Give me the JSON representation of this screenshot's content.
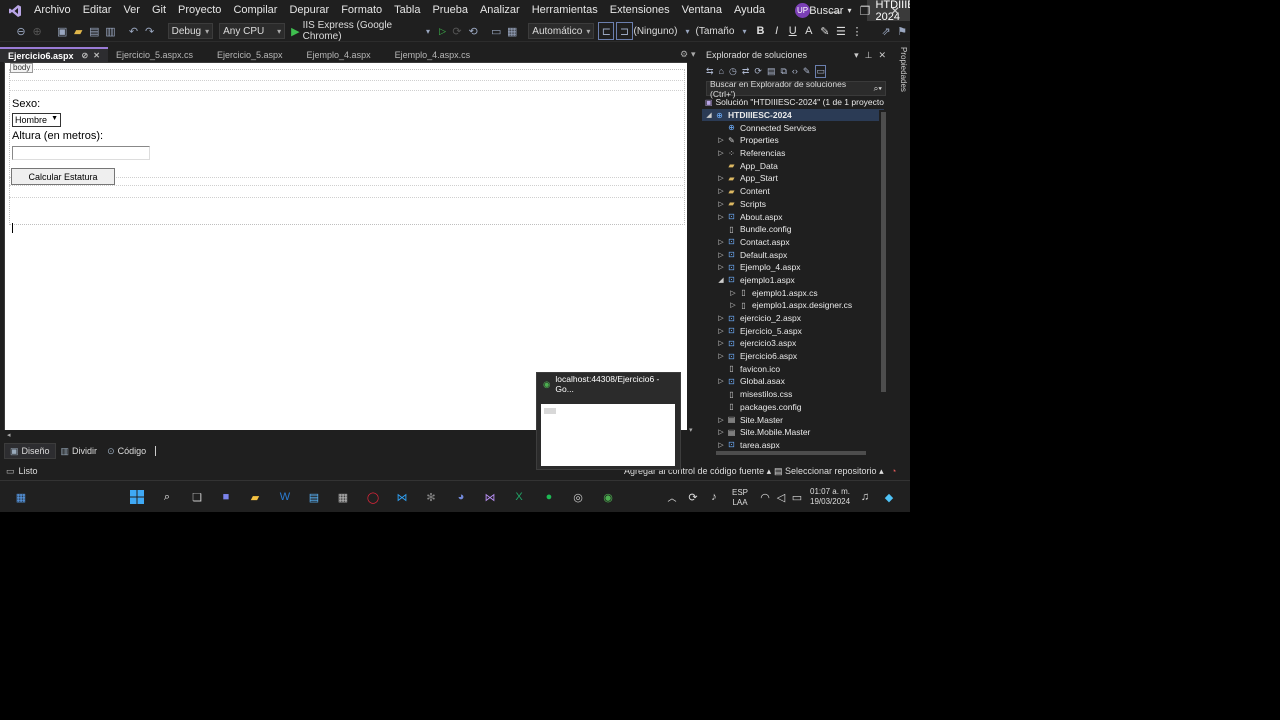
{
  "menu": {
    "items": [
      "Archivo",
      "Editar",
      "Ver",
      "Git",
      "Proyecto",
      "Compilar",
      "Depurar",
      "Formato",
      "Tabla",
      "Prueba",
      "Analizar",
      "Herramientas",
      "Extensiones",
      "Ventana",
      "Ayuda"
    ],
    "search_label": "Buscar",
    "solution_badge": "HTDIIIESC-2024",
    "avatar_initials": "UP"
  },
  "toolbar": {
    "config": "Debug",
    "platform": "Any CPU",
    "run_label": "IIS Express (Google Chrome)",
    "mode": "Automático",
    "style": "(Ninguno)",
    "size": "(Tamaño"
  },
  "doc_tabs": [
    {
      "label": "Ejercicio6.aspx",
      "active": true
    },
    {
      "label": "Ejercicio_5.aspx.cs"
    },
    {
      "label": "Ejercicio_5.aspx"
    },
    {
      "label": "Ejemplo_4.aspx"
    },
    {
      "label": "Ejemplo_4.aspx.cs"
    }
  ],
  "design": {
    "body_tag": "body",
    "sexo_label": "Sexo:",
    "select_value": "Hombre",
    "altura_label": "Altura (en metros):",
    "button_label": "Calcular Estatura"
  },
  "view_tabs": [
    "Diseño",
    "Dividir",
    "Código"
  ],
  "solution_explorer": {
    "title": "Explorador de soluciones",
    "search_placeholder": "Buscar en Explorador de soluciones (Ctrl+')",
    "solution_label": "Solución \"HTDIIIESC-2024\" (1 de 1 proyecto",
    "project": "HTDIIIESC-2024",
    "items": [
      {
        "label": "Connected Services",
        "indent": 2,
        "exp": "",
        "icon": "globe"
      },
      {
        "label": "Properties",
        "indent": 2,
        "exp": "▷",
        "icon": "wrench"
      },
      {
        "label": "Referencias",
        "indent": 2,
        "exp": "▷",
        "icon": "ref"
      },
      {
        "label": "App_Data",
        "indent": 2,
        "exp": "",
        "icon": "folder"
      },
      {
        "label": "App_Start",
        "indent": 2,
        "exp": "▷",
        "icon": "folder"
      },
      {
        "label": "Content",
        "indent": 2,
        "exp": "▷",
        "icon": "folder"
      },
      {
        "label": "Scripts",
        "indent": 2,
        "exp": "▷",
        "icon": "folder"
      },
      {
        "label": "About.aspx",
        "indent": 2,
        "exp": "▷",
        "icon": "page"
      },
      {
        "label": "Bundle.config",
        "indent": 2,
        "exp": "",
        "icon": "file"
      },
      {
        "label": "Contact.aspx",
        "indent": 2,
        "exp": "▷",
        "icon": "page"
      },
      {
        "label": "Default.aspx",
        "indent": 2,
        "exp": "▷",
        "icon": "page"
      },
      {
        "label": "Ejemplo_4.aspx",
        "indent": 2,
        "exp": "▷",
        "icon": "page"
      },
      {
        "label": "ejemplo1.aspx",
        "indent": 2,
        "exp": "◢",
        "icon": "page"
      },
      {
        "label": "ejemplo1.aspx.cs",
        "indent": 3,
        "exp": "▷",
        "icon": "file"
      },
      {
        "label": "ejemplo1.aspx.designer.cs",
        "indent": 3,
        "exp": "▷",
        "icon": "file"
      },
      {
        "label": "ejercicio_2.aspx",
        "indent": 2,
        "exp": "▷",
        "icon": "page"
      },
      {
        "label": "Ejercicio_5.aspx",
        "indent": 2,
        "exp": "▷",
        "icon": "page"
      },
      {
        "label": "ejercicio3.aspx",
        "indent": 2,
        "exp": "▷",
        "icon": "page"
      },
      {
        "label": "Ejercicio6.aspx",
        "indent": 2,
        "exp": "▷",
        "icon": "page"
      },
      {
        "label": "favicon.ico",
        "indent": 2,
        "exp": "",
        "icon": "file"
      },
      {
        "label": "Global.asax",
        "indent": 2,
        "exp": "▷",
        "icon": "page"
      },
      {
        "label": "misestilos.css",
        "indent": 2,
        "exp": "",
        "icon": "file"
      },
      {
        "label": "packages.config",
        "indent": 2,
        "exp": "",
        "icon": "file"
      },
      {
        "label": "Site.Master",
        "indent": 2,
        "exp": "▷",
        "icon": "master"
      },
      {
        "label": "Site.Mobile.Master",
        "indent": 2,
        "exp": "▷",
        "icon": "master"
      },
      {
        "label": "tarea.aspx",
        "indent": 2,
        "exp": "▷",
        "icon": "page"
      }
    ]
  },
  "properties_side_label": "Propiedades",
  "statusbar": {
    "status": "Listo",
    "source_control": "Agregar al control de código fuente",
    "repo": "Seleccionar repositorio"
  },
  "taskbar": {
    "lang": "ESP",
    "layout": "LAA",
    "time": "01:07 a. m.",
    "date": "19/03/2024"
  },
  "preview": {
    "title": "localhost:44308/Ejercicio6 - Go..."
  },
  "colors": {
    "accent": "#9a7bd6",
    "vs_purple": "#7b3fb5",
    "run_green": "#3fbf4f"
  }
}
